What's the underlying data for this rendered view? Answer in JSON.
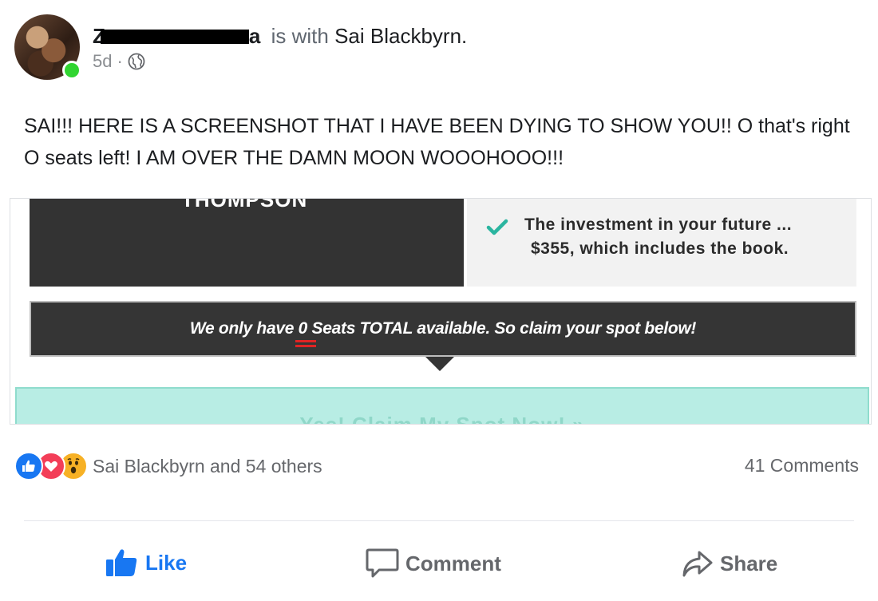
{
  "post": {
    "author_prefix": "Z",
    "author_suffix": "a",
    "with_text": "is with",
    "with_name": "Sai Blackbyrn.",
    "time": "5d",
    "dot": "·",
    "body": "SAI!!! HERE IS A SCREENSHOT THAT I HAVE BEEN DYING TO SHOW YOU!! O that's right O seats left! I AM OVER THE DAMN MOON WOOOHOOO!!!"
  },
  "screenshot": {
    "dark_title": "THOMPSON",
    "invest_line1": "The investment in your future ...",
    "invest_line2": "$355, which includes the book.",
    "banner_before": "We only have ",
    "banner_zero": "0",
    "banner_after": " Seats TOTAL available. So claim your spot below!",
    "cta": "Yes! Claim My Spot Now! »"
  },
  "reactions": {
    "text": "Sai Blackbyrn and 54 others",
    "comments": "41 Comments",
    "icons": [
      "like-icon",
      "love-icon",
      "wow-icon"
    ]
  },
  "actions": {
    "like": "Like",
    "comment": "Comment",
    "share": "Share"
  },
  "colors": {
    "accent": "#1877f2",
    "muted": "#65676b",
    "online": "#31d531"
  }
}
